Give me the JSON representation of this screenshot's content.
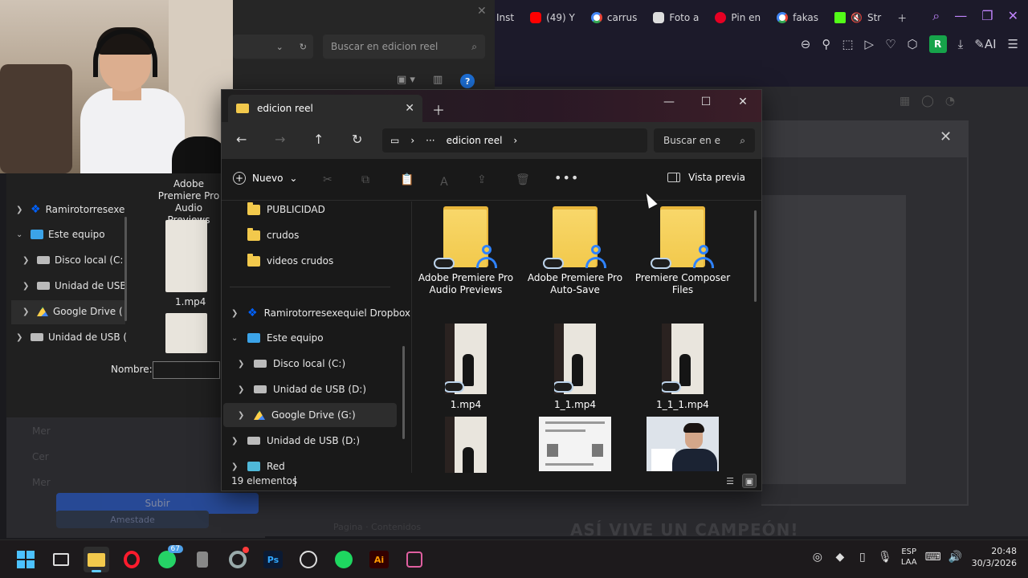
{
  "browser": {
    "tabs": [
      {
        "label": "Inst",
        "icon": "instagram-icon"
      },
      {
        "label": "(49) Y",
        "icon": "youtube-icon"
      },
      {
        "label": "carrus",
        "icon": "google-icon"
      },
      {
        "label": "Foto a",
        "icon": "instagram-icon"
      },
      {
        "label": "Pin en",
        "icon": "pinterest-icon"
      },
      {
        "label": "fakas",
        "icon": "google-icon"
      },
      {
        "label": "Str",
        "icon": "kick-icon"
      }
    ],
    "profile_initial": "R",
    "ai_label": "AI",
    "banner_text": "ASÍ VIVE UN CAMPEÓN!",
    "banner_sub": "Pagina · Contenidos",
    "colors": {
      "accent": "#c084fc",
      "profile": "#16a34a"
    }
  },
  "left_dialog": {
    "search_placeholder": "Buscar en edicion reel",
    "tree": [
      {
        "label": "Ramirotorresexe",
        "icon": "dropbox-icon"
      },
      {
        "label": "Este equipo",
        "icon": "computer-icon"
      },
      {
        "label": "Disco local (C:",
        "icon": "drive-icon"
      },
      {
        "label": "Unidad de USB",
        "icon": "usb-drive-icon"
      },
      {
        "label": "Google Drive (",
        "icon": "google-drive-icon"
      },
      {
        "label": "Unidad de USB (",
        "icon": "usb-drive-icon"
      }
    ],
    "thumb_label": "Adobe Premiere Pro Audio Previews",
    "file_label": "1.mp4",
    "nombre_label": "Nombre:",
    "ghost_items": [
      "Mer",
      "Cer",
      "Mer"
    ],
    "subir_label": "Subir",
    "subir_ghost": "Amestade"
  },
  "explorer": {
    "tab_title": "edicion reel",
    "breadcrumb": "edicion reel",
    "search_placeholder": "Buscar en e",
    "new_label": "Nuevo",
    "preview_label": "Vista previa",
    "nav": [
      {
        "label": "PUBLICIDAD",
        "icon": "folder-icon"
      },
      {
        "label": "crudos",
        "icon": "folder-icon"
      },
      {
        "label": "videos crudos",
        "icon": "folder-icon"
      },
      {
        "label": "Ramirotorresexequiel Dropbox",
        "icon": "dropbox-icon"
      },
      {
        "label": "Este equipo",
        "icon": "computer-icon"
      },
      {
        "label": "Disco local (C:)",
        "icon": "drive-icon"
      },
      {
        "label": "Unidad de USB (D:)",
        "icon": "usb-drive-icon"
      },
      {
        "label": "Google Drive (G:)",
        "icon": "google-drive-icon"
      },
      {
        "label": "Unidad de USB (D:)",
        "icon": "usb-drive-icon"
      },
      {
        "label": "Red",
        "icon": "network-icon"
      }
    ],
    "items": [
      {
        "name": "Adobe Premiere Pro Audio Previews",
        "type": "shared-folder"
      },
      {
        "name": "Adobe Premiere Pro Auto-Save",
        "type": "shared-folder"
      },
      {
        "name": "Premiere Composer Files",
        "type": "shared-folder"
      },
      {
        "name": "1.mp4",
        "type": "video"
      },
      {
        "name": "1_1.mp4",
        "type": "video"
      },
      {
        "name": "1_1_1.mp4",
        "type": "video"
      },
      {
        "name": "",
        "type": "video"
      },
      {
        "name": "",
        "type": "document"
      },
      {
        "name": "",
        "type": "photo"
      }
    ],
    "status_count": "19 elementos"
  },
  "taskbar": {
    "apps": [
      "start-icon",
      "task-view-icon",
      "file-explorer-icon",
      "opera-icon",
      "whatsapp-icon",
      "app-icon",
      "chrome-icon",
      "photoshop-icon",
      "chatgpt-icon",
      "spotify-icon",
      "illustrator-icon",
      "snipping-tool-icon"
    ],
    "whatsapp_badge": "67",
    "ps_label": "Ps",
    "ai_label": "Ai",
    "lang_line1": "ESP",
    "lang_line2": "LAA",
    "time": "20:48",
    "date": "30/3/2026"
  }
}
